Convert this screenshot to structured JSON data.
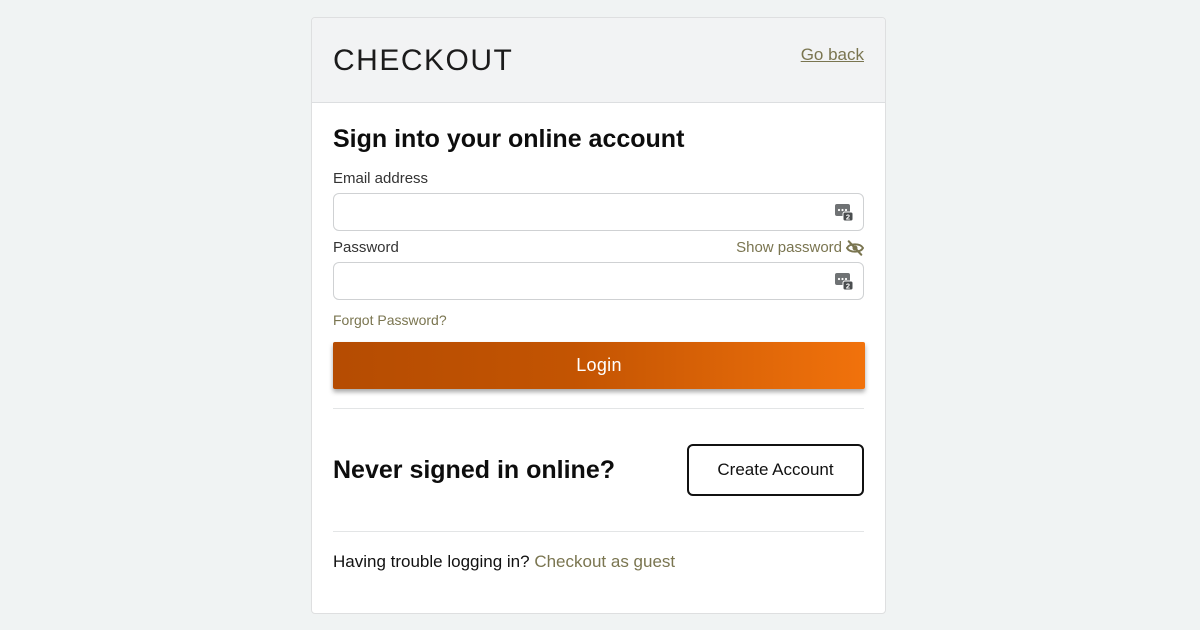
{
  "header": {
    "title": "CHECKOUT",
    "back_link": "Go back"
  },
  "signin": {
    "heading": "Sign into your online account",
    "email_label": "Email address",
    "email_value": "",
    "password_label": "Password",
    "password_value": "",
    "show_password": "Show password",
    "forgot_password": "Forgot Password?",
    "login_label": "Login"
  },
  "signup": {
    "heading": "Never signed in online?",
    "create_account_label": "Create Account"
  },
  "trouble": {
    "text": "Having trouble logging in?",
    "guest_link": "Checkout as guest"
  },
  "colors": {
    "page_background": "#f0f3f3",
    "accent_link": "#7a7550",
    "login_gradient_start": "#b54c02",
    "login_gradient_end": "#f1720c"
  },
  "icons": {
    "field_icon": "password-manager-icon",
    "show_password_icon": "eye-slash-icon"
  }
}
